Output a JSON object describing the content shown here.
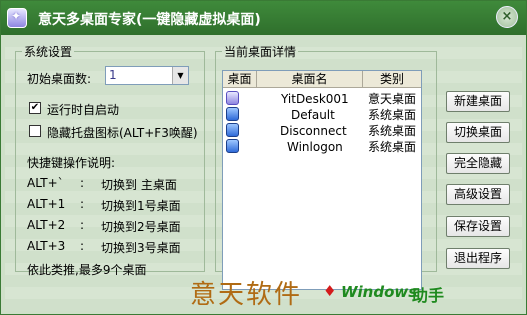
{
  "window": {
    "title": "意天多桌面专家(一键隐藏虚拟桌面)",
    "close_glyph": "×"
  },
  "settings": {
    "legend": "系统设置",
    "init_desktops_label": "初始桌面数:",
    "init_desktops_value": "1",
    "autostart_label": "运行时自启动",
    "autostart_checked": true,
    "hide_tray_label": "隐藏托盘图标(ALT+F3唤醒)",
    "hide_tray_checked": false,
    "hotkeys_title": "快捷键操作说明:",
    "hotkeys": [
      {
        "key": "ALT+`",
        "sep": ":",
        "desc": "切换到 主桌面"
      },
      {
        "key": "ALT+1",
        "sep": ":",
        "desc": "切换到1号桌面"
      },
      {
        "key": "ALT+2",
        "sep": ":",
        "desc": "切换到2号桌面"
      },
      {
        "key": "ALT+3",
        "sep": ":",
        "desc": "切换到3号桌面"
      }
    ],
    "footer_note": "依此类推,最多9个桌面"
  },
  "desktops": {
    "legend": "当前桌面详情",
    "columns": [
      "桌面",
      "桌面名",
      "类别"
    ],
    "rows": [
      {
        "name": "YitDesk001",
        "type": "意天桌面",
        "icon": "yitian-desktop-icon"
      },
      {
        "name": "Default",
        "type": "系统桌面",
        "icon": "system-desktop-icon"
      },
      {
        "name": "Disconnect",
        "type": "系统桌面",
        "icon": "system-desktop-icon"
      },
      {
        "name": "Winlogon",
        "type": "系统桌面",
        "icon": "system-desktop-icon"
      }
    ]
  },
  "buttons": {
    "new": "新建桌面",
    "switch": "切换桌面",
    "hide_all": "完全隐藏",
    "advanced": "高级设置",
    "save": "保存设置",
    "exit": "退出程序"
  },
  "brand": {
    "name": "意天软件",
    "sub": "Windows",
    "sub2": "助手"
  },
  "colors": {
    "titlebar": "#3f8a3b",
    "window_bg": "#d7e5d2",
    "brand": "#b06b14",
    "accent_green": "#1f8a1f"
  }
}
